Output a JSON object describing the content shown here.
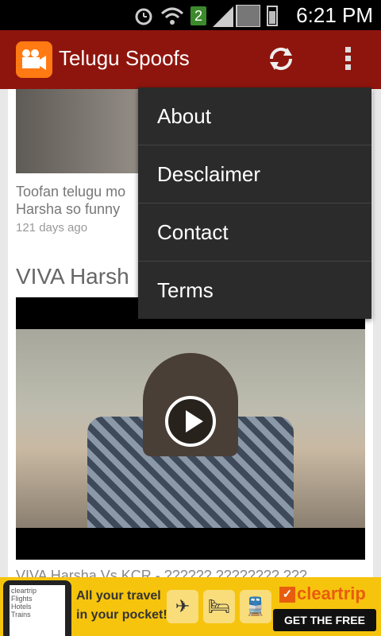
{
  "status_bar": {
    "time": "6:21 PM",
    "sim_badge": "2",
    "icons": [
      "alarm-icon",
      "wifi-icon",
      "signal-icon",
      "battery-icon"
    ]
  },
  "action_bar": {
    "title": "Telugu Spoofs",
    "app_icon": "video-camera-icon",
    "refresh_icon": "refresh-icon",
    "overflow_icon": "overflow-menu-icon",
    "color": "#8e150d"
  },
  "feed": {
    "items": [
      {
        "title": "Toofan telugu mo Harsha so funny",
        "age": "121 days ago"
      },
      {
        "title": "VIVA Harsh",
        "subtitle": "VIVA Harsha Vs KCR - ?????? ???????? ???"
      }
    ]
  },
  "menu": {
    "items": [
      {
        "label": "About"
      },
      {
        "label": "Desclaimer"
      },
      {
        "label": "Contact"
      },
      {
        "label": "Terms"
      }
    ]
  },
  "ad": {
    "line1": "All your travel",
    "line2": "in your pocket!",
    "brand": "cleartrip",
    "cta": "GET THE FREE APP",
    "screen_lines": [
      "cleartrip",
      "Flights",
      "Hotels",
      "Trains"
    ],
    "tiles": [
      "flight-icon",
      "hotel-icon",
      "train-icon"
    ]
  }
}
